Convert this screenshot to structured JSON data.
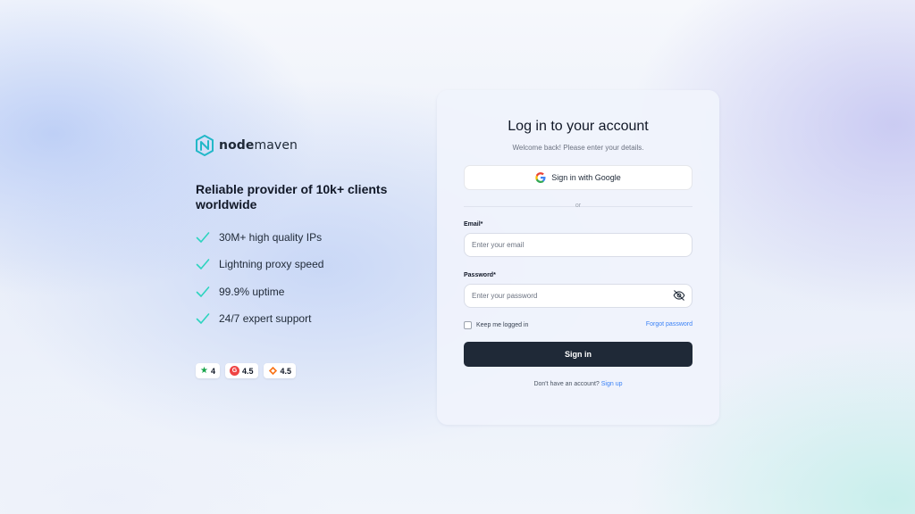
{
  "brand": {
    "logo_prefix": "node",
    "logo_suffix": "maven",
    "logo_color": "#22b8c8"
  },
  "hero": {
    "tagline": "Reliable provider of 10k+ clients worldwide",
    "features": [
      "30M+ high quality IPs",
      "Lightning proxy speed",
      "99.9% uptime",
      "24/7 expert support"
    ],
    "check_icon": "check-icon",
    "check_color": "#2dd4bf"
  },
  "ratings": [
    {
      "icon": "trustpilot-star-icon",
      "value": "4"
    },
    {
      "icon": "g2-icon",
      "value": "4.5"
    },
    {
      "icon": "capterra-icon",
      "value": "4.5"
    }
  ],
  "login": {
    "title": "Log in to your account",
    "subtitle": "Welcome back! Please enter your details.",
    "google_label": "Sign in with Google",
    "divider_text": "or",
    "email_label": "Email*",
    "email_placeholder": "Enter your email",
    "email_value": "",
    "password_label": "Password*",
    "password_placeholder": "Enter your password",
    "password_value": "",
    "remember_label": "Keep me logged in",
    "remember_checked": false,
    "forgot_label": "Forgot password",
    "signin_label": "Sign in",
    "signup_prompt": "Don't have an account?",
    "signup_label": "Sign up",
    "primary_color": "#1f2937",
    "link_color": "#3b82f6"
  }
}
